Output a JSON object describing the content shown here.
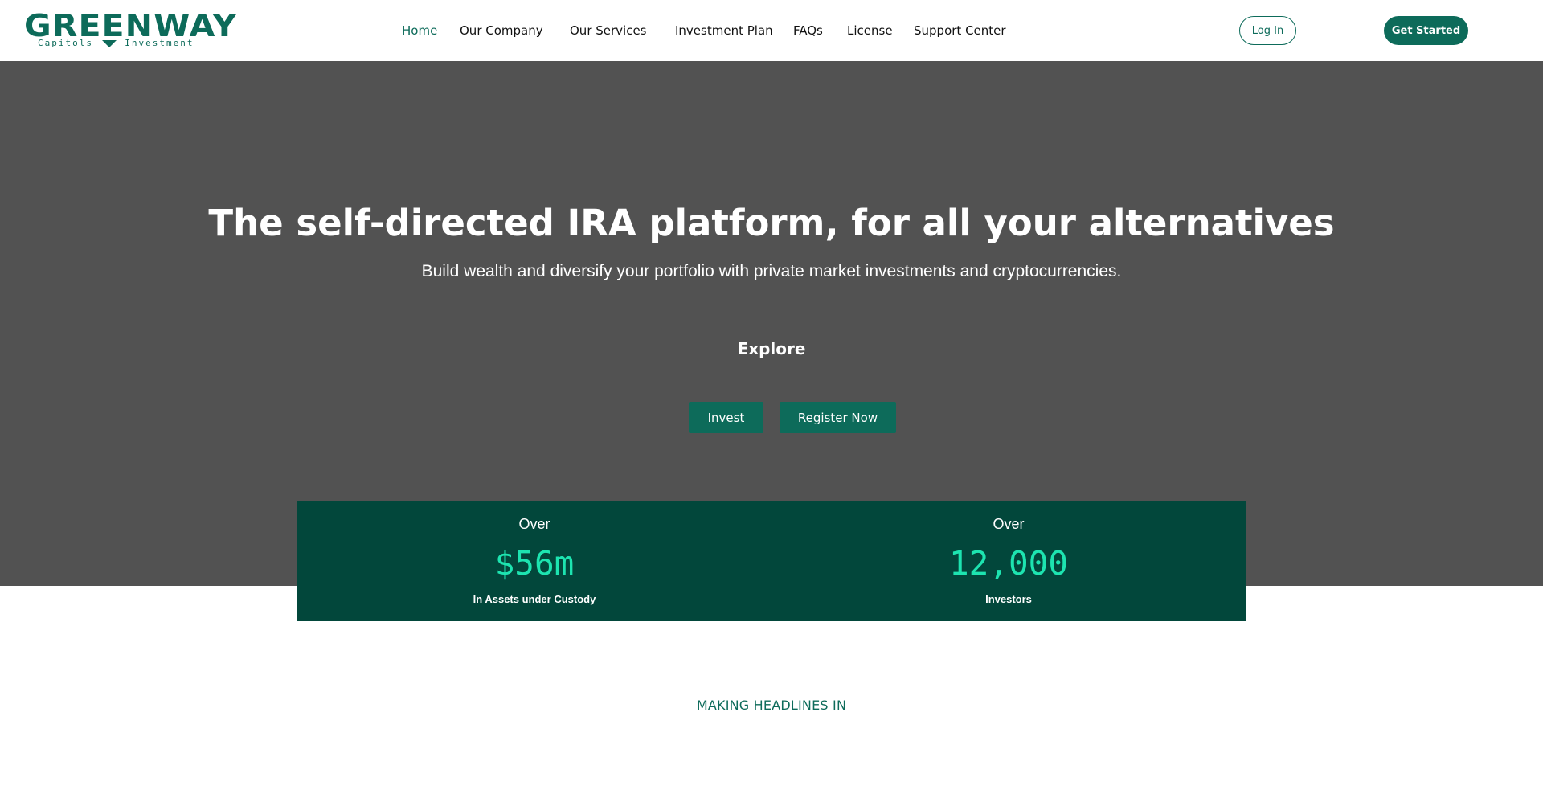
{
  "brand": {
    "logo_main": "GREENWAY",
    "logo_sub_left": "Capitols",
    "logo_sub_right": "Investment",
    "accent_color": "#0d6b5a",
    "stats_bg_color": "#02473b",
    "stat_value_color": "#1de4b0",
    "hero_bg_color": "#525252"
  },
  "nav": {
    "items": [
      {
        "label": "Home",
        "active": true
      },
      {
        "label": "Our Company"
      },
      {
        "label": "Our Services"
      },
      {
        "label": "Investment Plan"
      },
      {
        "label": "FAQs"
      },
      {
        "label": "License"
      },
      {
        "label": "Support Center"
      }
    ],
    "login_label": "Log In",
    "get_started_label": "Get Started"
  },
  "hero": {
    "title": "The self-directed IRA platform, for all your alternatives",
    "subtitle": "Build wealth and diversify your portfolio with private market investments and cryptocurrencies.",
    "explore_label": "Explore",
    "invest_label": "Invest",
    "register_label": "Register Now"
  },
  "stats": [
    {
      "prefix": "Over",
      "value": "$56m",
      "label": "In Assets under Custody"
    },
    {
      "prefix": "Over",
      "value": "12,000",
      "label": "Investors"
    }
  ],
  "headlines": {
    "label": "MAKING HEADLINES IN"
  }
}
